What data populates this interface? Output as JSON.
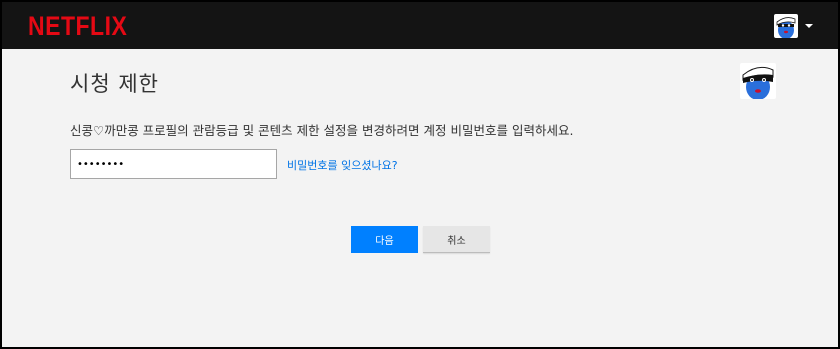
{
  "header": {
    "logo_text": "NETFLIX",
    "logo_color": "#e50914",
    "avatar_icon": "robber-avatar-icon",
    "menu_icon": "caret-down-icon"
  },
  "main": {
    "title": "시청 제한",
    "profile_avatar_icon": "robber-avatar-icon",
    "instruction": "신콩♡까만콩 프로필의 관람등급 및 콘텐츠 제한 설정을 변경하려면 계정 비밀번호를 입력하세요.",
    "password_value": "••••••••",
    "forgot_link": "비밀번호를 잊으셨나요?",
    "next_button": "다음",
    "cancel_button": "취소"
  },
  "colors": {
    "accent": "#0080ff",
    "link": "#0073e6",
    "header_bg": "#141414",
    "page_bg": "#f3f3f3"
  }
}
